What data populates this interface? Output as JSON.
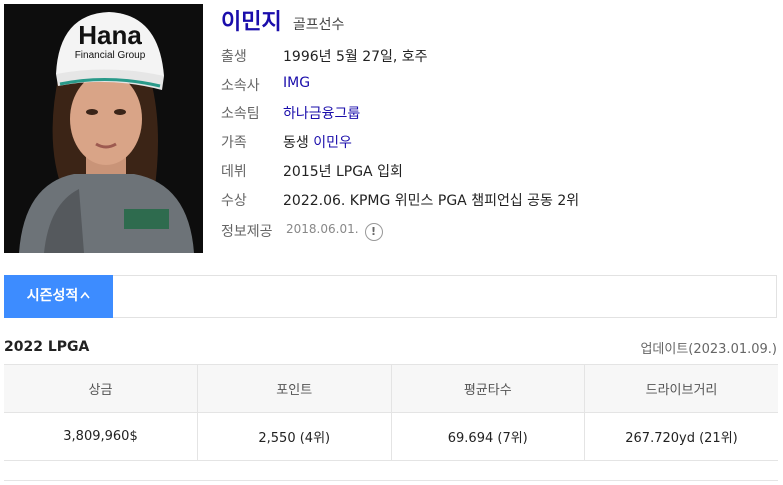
{
  "profile": {
    "name": "이민지",
    "job": "골프선수",
    "cap_text_1": "Hana",
    "cap_text_2": "Financial Group",
    "rows": [
      {
        "label": "출생",
        "value": "1996년 5월 27일, 호주"
      },
      {
        "label": "소속사",
        "value": "IMG"
      },
      {
        "label": "소속팀",
        "value": "하나금융그룹"
      },
      {
        "label": "가족",
        "prefix": "동생 ",
        "link": "이민우"
      },
      {
        "label": "데뷔",
        "value": "2015년 LPGA 입회"
      },
      {
        "label": "수상",
        "value": "2022.06. KPMG 위민스 PGA 챔피언십 공동 2위"
      }
    ],
    "source_label": "정보제공",
    "source_date": "2018.06.01.",
    "info_icon_glyph": "!"
  },
  "tabs": {
    "active_label": "시즌성적",
    "active_chevron": "^"
  },
  "season": {
    "title": "2022 LPGA",
    "updated": "업데이트(2023.01.09.)",
    "columns": [
      "상금",
      "포인트",
      "평균타수",
      "드라이브거리"
    ],
    "values": [
      "3,809,960$",
      "2,550 (4위)",
      "69.694 (7위)",
      "267.720yd (21위)"
    ]
  },
  "colors": {
    "accent": "#3d8cff",
    "link": "#1a0dab"
  }
}
